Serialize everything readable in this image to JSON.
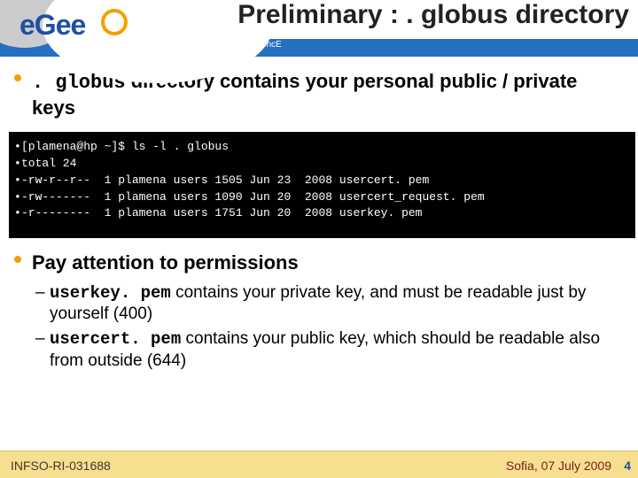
{
  "header": {
    "logo_text": "eGee",
    "title": "Preliminary : . globus directory",
    "tagline": "Enabling Grids for E-sciencE"
  },
  "bullets": {
    "b1_mono": ". globus",
    "b1_rest": " directory contains your personal public / private keys",
    "code_lines": [
      "[plamena@hp ~]$ ls -l . globus",
      "total 24",
      "-rw-r--r--  1 plamena users 1505 Jun 23  2008 usercert. pem",
      "-rw-------  1 plamena users 1090 Jun 20  2008 usercert_request. pem",
      "-r--------  1 plamena users 1751 Jun 20  2008 userkey. pem"
    ],
    "b2_text": "Pay attention to permissions",
    "sub1_mono": "userkey. pem",
    "sub1_rest": "  contains your private key, and must be readable just by yourself (400)",
    "sub2_mono": "usercert. pem",
    "sub2_rest": "  contains your public key, which should be readable also from outside (644)"
  },
  "footer": {
    "left": "INFSO-RI-031688",
    "right": "Sofia, 07 July 2009",
    "page": "4"
  }
}
